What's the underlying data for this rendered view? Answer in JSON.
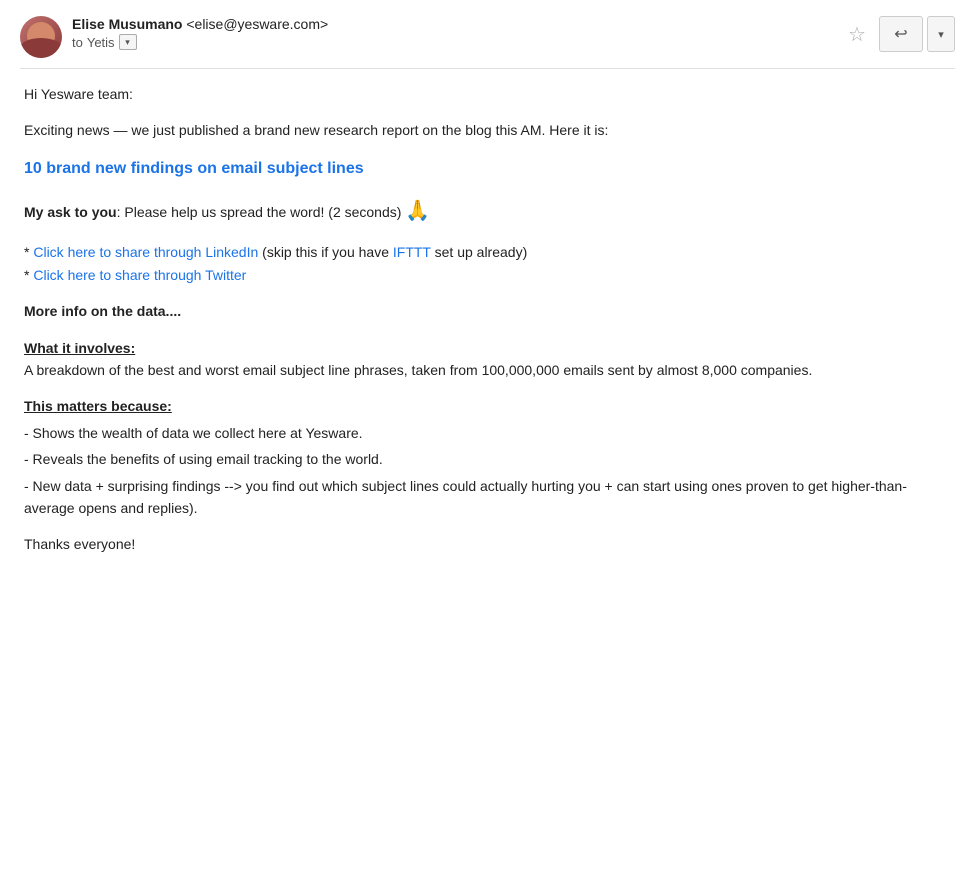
{
  "header": {
    "sender_name": "Elise Musumano",
    "sender_email": "<elise@yesware.com>",
    "to_label": "to",
    "to_recipient": "Yetis",
    "star_icon": "☆",
    "reply_icon": "↩",
    "dropdown_icon": "▾"
  },
  "body": {
    "greeting": "Hi Yesware team:",
    "intro": "Exciting news — we just published a brand new research report on the blog this AM. Here it is:",
    "link_main": "10 brand new findings on email subject lines",
    "ask_bold": "My ask to you",
    "ask_text": ": Please help us spread the word! (2 seconds)",
    "prayer_emoji": "🙏",
    "linkedin_link": "Click here to share through LinkedIn",
    "linkedin_text": " (skip this if you have ",
    "ifttt_link": "IFTTT",
    "linkedin_text2": " set up already)",
    "twitter_link": "Click here to share through Twitter",
    "more_info_heading": "More info on the data....",
    "what_involves_heading": "What it involves:",
    "what_involves_text": "A breakdown of the best and worst email subject line phrases, taken from 100,000,000 emails sent by almost 8,000 companies.",
    "matters_heading": "This matters because:",
    "matters_bullet1": "- Shows the wealth of data we collect here at Yesware.",
    "matters_bullet2": "- Reveals the benefits of using email tracking to the world.",
    "matters_bullet3": "- New data + surprising findings --> you find out which subject lines could actually hurting you + can start using ones proven to get higher-than-average opens and replies).",
    "closing": "Thanks everyone!"
  }
}
